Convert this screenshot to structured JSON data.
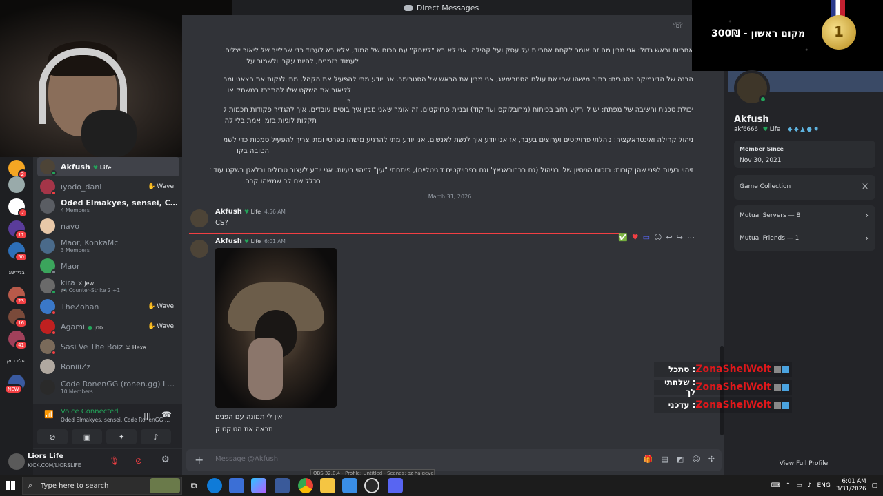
{
  "titlebar": {
    "title": "Direct Messages"
  },
  "server_rail": {
    "items": [
      {
        "badge": "2"
      },
      {
        "badge": ""
      },
      {
        "badge": "2"
      },
      {
        "badge": "11"
      },
      {
        "badge": "50"
      },
      {
        "badge": "23"
      },
      {
        "badge": "16"
      },
      {
        "badge": "41"
      },
      {
        "badge": "NEW"
      }
    ],
    "text_labels": [
      "בלידשא",
      "הוליבביוק"
    ]
  },
  "dm_list": {
    "items": [
      {
        "name": "Akfush",
        "tag": "Life",
        "sub": "",
        "wave": "",
        "active": true
      },
      {
        "name": "ıyodo_dani",
        "tag": "",
        "sub": "",
        "wave": "Wave"
      },
      {
        "name": "Oded Elmakyes, sensei, Code Rone...",
        "tag": "",
        "sub": "4 Members",
        "wave": "",
        "bright": true
      },
      {
        "name": "navo",
        "tag": "",
        "sub": "",
        "wave": ""
      },
      {
        "name": "Maor, KonkaMc",
        "tag": "",
        "sub": "3 Members",
        "wave": ""
      },
      {
        "name": "Maor",
        "tag": "",
        "sub": "",
        "wave": ""
      },
      {
        "name": "kira",
        "tag": "jew",
        "sub": "Counter-Strike 2 +1",
        "wave": ""
      },
      {
        "name": "TheZohan",
        "tag": "",
        "sub": "",
        "wave": "Wave"
      },
      {
        "name": "Agami",
        "tag": "סטן",
        "sub": "",
        "wave": "Wave"
      },
      {
        "name": "Sasi Ve The Boiz",
        "tag": "Hexa",
        "sub": "",
        "wave": ""
      },
      {
        "name": "RoniiiZz",
        "tag": "",
        "sub": "",
        "wave": ""
      },
      {
        "name": "Code RonenGG (ronen.gg) LB, IGZ, ...",
        "tag": "",
        "sub": "10 Members",
        "wave": ""
      }
    ]
  },
  "voice": {
    "status": "Voice Connected",
    "channel": "Oded Elmakyes, sensei, Code RonenGG (ron..."
  },
  "user_panel": {
    "name": "Liors Life",
    "status": "KICK.COM/LIORSLIFE"
  },
  "chat": {
    "paragraphs": [
      "אחריות וראש גדול: אני מבין מה זה אומר לקחת אחריות על עסק ועל קהילה. אני לא בא \"לשחק\" עם הכוח של המוד, אלא בא לעבוד כדי שהלייב של ליאור יצליח. אני יודע מ",
      "לעמוד בזמנים, להיות עקבי ולשמור על",
      "הבנה של הדינמיקה בסטרים: בתור מישהו שחי את עולם הסטרימינג, אני מבין את הראש של הסטרימר. אני יודע מתי להפעיל את הקהל, מתי לנקות את הצאט ומתי פשוט",
      "לליאור את השקט שלו להתרכז במשחק או ב",
      "יכולת טכנית וחשיבה של מפתח: יש לי רקע רחב בפיתוח (מרובלוקס ועד קוד) ובניית פרויקטים. זה אומר שאני מבין איך בוטים עובדים, איך להגדיר פקודות חכמות לצאט ואיך ל",
      "תקלות לוגיות בזמן אמת בלי לה",
      "ניהול קהילה ואינטראקציה: ניהלתי פרויקטים וערוצים בעבר, אז אני יודע איך לגשת לאנשים. אני יודע מתי להרגיע מישהו בפרטי ומתי צריך להפעיל סמכות כדי לשמור על הא",
      "הטובה בקו",
      "זיהוי בעיות לפני שהן קורות: בזכות הניסיון שלי בניהול (גם בברוראגאץ' וגם בפרויקטים דיגיטליים), פיתחתי \"עין\" לזיהוי בעיות. אני יודע לעצור טרולים ובלאגן בשקט עוד לפני שליאור",
      "בכלל שם לב שמשהו קרה."
    ],
    "date_divider": "March 31, 2026",
    "messages": [
      {
        "author": "Akfush",
        "tag": "Life",
        "time": "4:56 AM",
        "text": "CS?"
      },
      {
        "author": "Akfush",
        "tag": "Life",
        "time": "6:01 AM",
        "text": ""
      }
    ],
    "after_image": [
      "אין לי תמונה עם הפנים",
      "תראה את הטיקטוק"
    ],
    "input_placeholder": "Message @Akfush"
  },
  "profile": {
    "banner_text": "מקום ראשון - 300₪",
    "banner_medal": "1",
    "name": "Akfush",
    "username": "akf6666",
    "tag": "Life",
    "member_since_label": "Member Since",
    "member_since": "Nov 30, 2021",
    "game_collection": "Game Collection",
    "mutual_servers": "Mutual Servers — 8",
    "mutual_friends": "Mutual Friends — 1",
    "view_full": "View Full Profile"
  },
  "stream_chat": [
    {
      "user": "ZonaShelWolt",
      "message": "סתכל"
    },
    {
      "user": "ZonaShelWolt",
      "message": "שלחתי לך"
    },
    {
      "user": "ZonaShelWolt",
      "message": "עדכני"
    }
  ],
  "taskbar": {
    "search_placeholder": "Type here to search",
    "obs_tooltip": "OBS 32.0.4 - Profile: Untitled - Scenes: oz ha'gever",
    "lang": "ENG",
    "time": "6:01 AM",
    "date": "3/31/2026"
  },
  "colors": {
    "online": "#23a55a",
    "idle": "#f0b232",
    "dnd": "#f23f43",
    "stream_user": "#e0181b",
    "accent": "#5865f2"
  }
}
